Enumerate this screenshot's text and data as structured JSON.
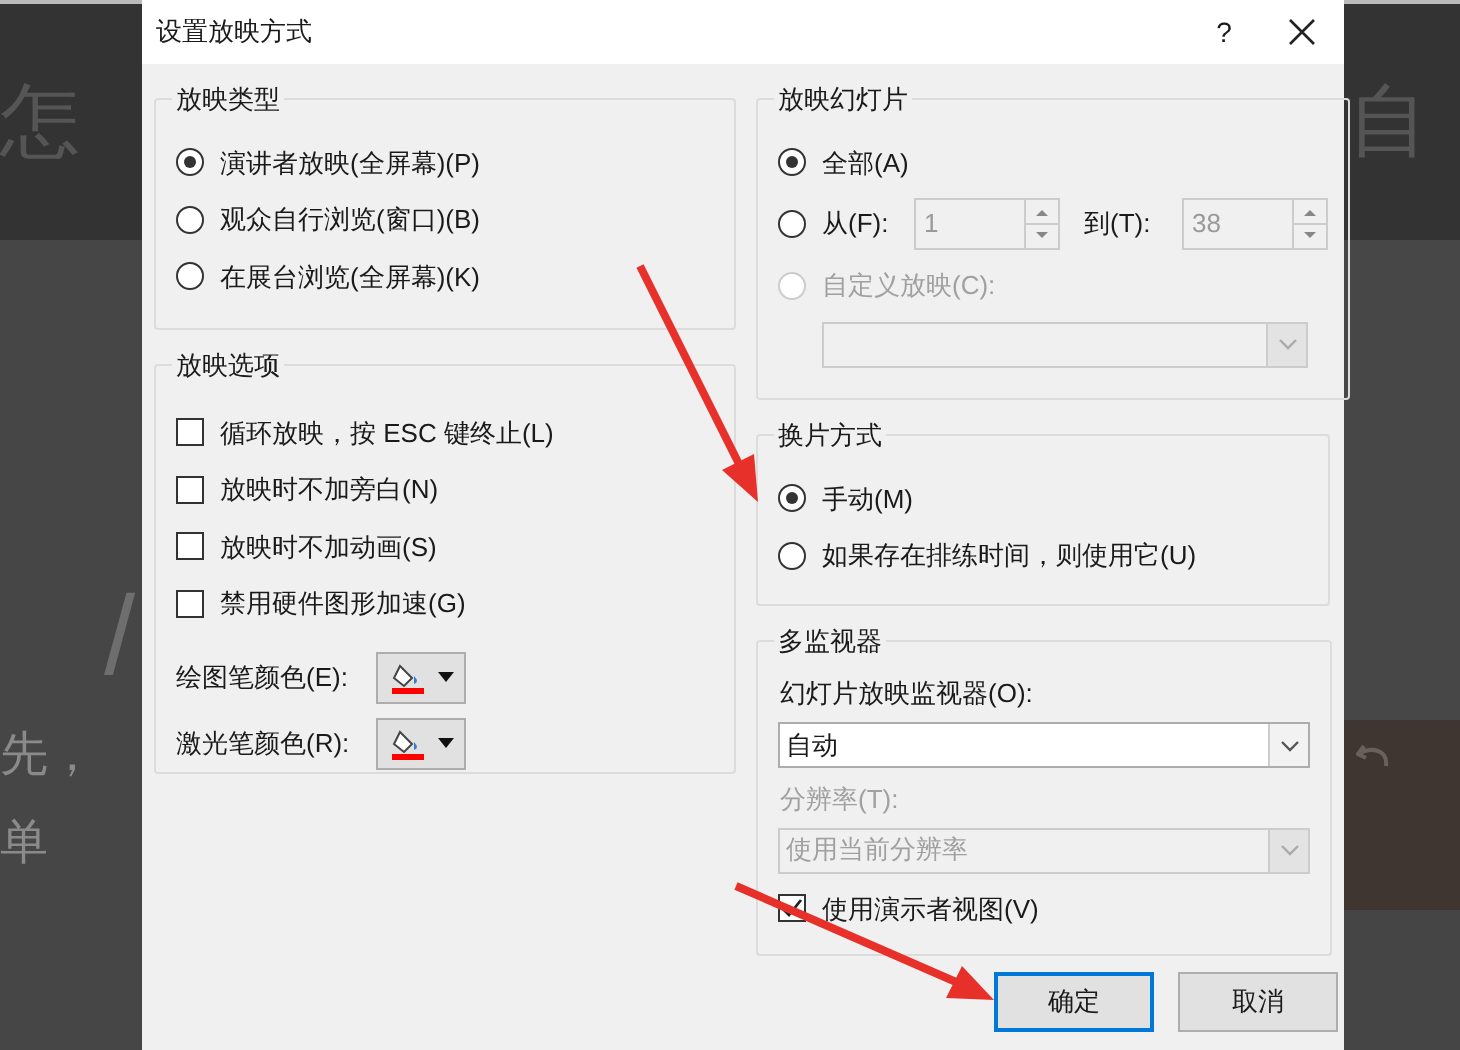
{
  "background": {
    "left_texts": [
      {
        "text": "怎",
        "kind": "title"
      },
      {
        "text": "/",
        "kind": "number"
      },
      {
        "text": "先，",
        "kind": "body"
      },
      {
        "text": "单",
        "kind": "body"
      }
    ],
    "right_texts": [
      {
        "text": "自"
      }
    ]
  },
  "dialog": {
    "title": "设置放映方式",
    "help": "?",
    "show_type": {
      "title": "放映类型",
      "options": [
        {
          "label": "演讲者放映(全屏幕)(P)",
          "selected": true
        },
        {
          "label": "观众自行浏览(窗口)(B)",
          "selected": false
        },
        {
          "label": "在展台浏览(全屏幕)(K)",
          "selected": false
        }
      ]
    },
    "show_options": {
      "title": "放映选项",
      "checkboxes": [
        {
          "label": "循环放映，按 ESC 键终止(L)",
          "checked": false
        },
        {
          "label": "放映时不加旁白(N)",
          "checked": false
        },
        {
          "label": "放映时不加动画(S)",
          "checked": false
        },
        {
          "label": "禁用硬件图形加速(G)",
          "checked": false
        }
      ],
      "pen_colors": [
        {
          "label": "绘图笔颜色(E):"
        },
        {
          "label": "激光笔颜色(R):"
        }
      ]
    },
    "show_slides": {
      "title": "放映幻灯片",
      "options": [
        {
          "kind": "all",
          "label": "全部(A)",
          "selected": true,
          "disabled": false
        },
        {
          "kind": "range",
          "label": "从(F):",
          "selected": false,
          "disabled": false,
          "from_value": "1",
          "to_label": "到(T):",
          "to_value": "38"
        },
        {
          "kind": "custom",
          "label": "自定义放映(C):",
          "selected": false,
          "disabled": true
        }
      ]
    },
    "advance": {
      "title": "换片方式",
      "options": [
        {
          "label": "手动(M)",
          "selected": true
        },
        {
          "label": "如果存在排练时间，则使用它(U)",
          "selected": false
        }
      ]
    },
    "monitors": {
      "title": "多监视器",
      "monitor_label": "幻灯片放映监视器(O):",
      "monitor_value": "自动",
      "resolution_label": "分辨率(T):",
      "resolution_value": "使用当前分辨率",
      "resolution_disabled": true,
      "presenter_view": {
        "label": "使用演示者视图(V)",
        "checked": true
      }
    },
    "buttons": [
      {
        "label": "确定",
        "default": true
      },
      {
        "label": "取消",
        "default": false
      }
    ]
  }
}
